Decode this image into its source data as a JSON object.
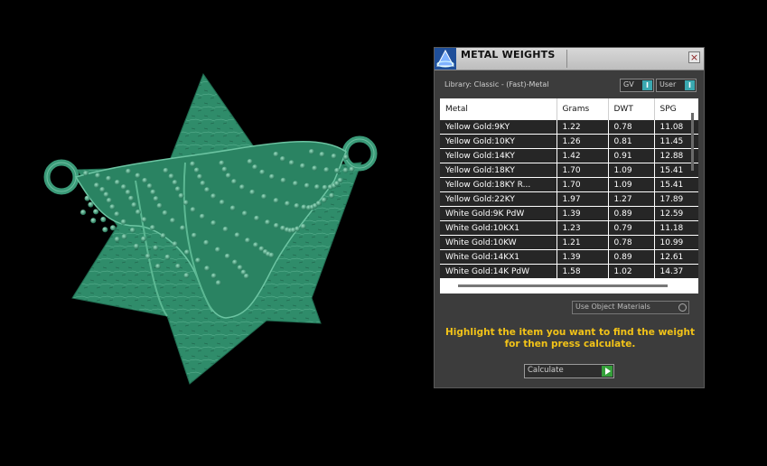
{
  "panel": {
    "title": "METAL WEIGHTS",
    "close_glyph": "×",
    "library_label": "Library: Classic - (Fast)-Metal",
    "toggles": [
      {
        "label": "GV",
        "knob": "I"
      },
      {
        "label": "User",
        "knob": "I"
      }
    ],
    "table": {
      "headers": [
        "Metal",
        "Grams",
        "DWT",
        "SPG"
      ],
      "rows": [
        [
          "Yellow Gold:9KY",
          "1.22",
          "0.78",
          "11.08"
        ],
        [
          "Yellow Gold:10KY",
          "1.26",
          "0.81",
          "11.45"
        ],
        [
          "Yellow Gold:14KY",
          "1.42",
          "0.91",
          "12.88"
        ],
        [
          "Yellow Gold:18KY",
          "1.70",
          "1.09",
          "15.41"
        ],
        [
          "Yellow Gold:18KY R...",
          "1.70",
          "1.09",
          "15.41"
        ],
        [
          "Yellow Gold:22KY",
          "1.97",
          "1.27",
          "17.89"
        ],
        [
          "White Gold:9K PdW",
          "1.39",
          "0.89",
          "12.59"
        ],
        [
          "White Gold:10KX1",
          "1.23",
          "0.79",
          "11.18"
        ],
        [
          "White Gold:10KW",
          "1.21",
          "0.78",
          "10.99"
        ],
        [
          "White Gold:14KX1",
          "1.39",
          "0.89",
          "12.61"
        ],
        [
          "White Gold:14K PdW",
          "1.58",
          "1.02",
          "14.37"
        ]
      ]
    },
    "use_object_materials": "Use Object Materials",
    "instructions_line1": "Highlight the item you want to find the weight",
    "instructions_line2": "for then press calculate.",
    "calculate_label": "Calculate"
  },
  "colors": {
    "model": "#2f8c6a",
    "accent_yellow": "#f2c318",
    "toggle_teal": "#3aa8b0",
    "calc_green": "#35a03a"
  },
  "icons": {
    "app_logo": "pyramid-logo-icon",
    "close": "close-icon",
    "calculate": "play-arrow-icon"
  }
}
